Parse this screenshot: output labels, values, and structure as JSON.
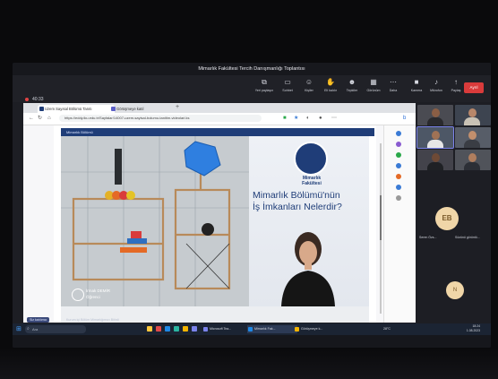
{
  "meeting": {
    "title": "Mimarlık Fakültesi Tercih Danışmanlığı Toplantısı",
    "timer": "40:33",
    "toolbar": [
      {
        "icon": "share-screen-icon",
        "label": "Yeri paylaşın"
      },
      {
        "icon": "chat-icon",
        "label": "Sohbet"
      },
      {
        "icon": "people-icon",
        "label": "Kişiler"
      },
      {
        "icon": "raise-hand-icon",
        "label": "Eli kaldır"
      },
      {
        "icon": "react-icon",
        "label": "Tepkiler"
      },
      {
        "icon": "view-icon",
        "label": "Görünüm"
      },
      {
        "icon": "more-icon",
        "label": "Daha"
      },
      {
        "icon": "camera-icon",
        "label": "Kamera"
      },
      {
        "icon": "mic-icon",
        "label": "Mikrofon"
      },
      {
        "icon": "speaker-icon",
        "label": "Paylaş"
      }
    ],
    "leave_label": "Ayrıl"
  },
  "browser": {
    "tabs": [
      {
        "label": "Uzem Sayısal Bölümü Tanıtı"
      },
      {
        "label": "Görüşmeye katıl"
      }
    ],
    "url": "https://eddy.iku.edu.tr/Sayfalar/14007-uzem-sayisal-bolumu-tanitim-videolari.ks",
    "section_label": "Mimarlık Bölümü"
  },
  "video": {
    "school_caption_1": "Mimarlık",
    "school_caption_2": "Fakültesi",
    "headline_1": "Mimarlık Bölümü'nün",
    "headline_2": "İş İmkanları Nelerdir?",
    "lower_name": "İrmak DEMİR",
    "lower_role": "Öğrenci"
  },
  "participants": {
    "eb_initials": "EB",
    "eb_name": "Seren Özs...",
    "eb_sub": "Sözünü görüntü...",
    "n_initials": "N",
    "badge": "Siz katılımcı"
  },
  "taskbar": {
    "search": "Ara",
    "apps": [
      {
        "label": "Microsoft Tea..."
      },
      {
        "label": "Mimarlık Fak..."
      },
      {
        "label": "Görüşmeye k..."
      }
    ],
    "weather": "28°C",
    "time": "18:24",
    "date": "1.08.2023",
    "caption_strip": "Kurum içi Bölüm Mimarlığımızı Bitirdi"
  },
  "colors": {
    "accent_red": "#d93b3b",
    "teams_dark": "#202127",
    "section_blue": "#1f3d78",
    "taskbar": "#1b2433"
  }
}
